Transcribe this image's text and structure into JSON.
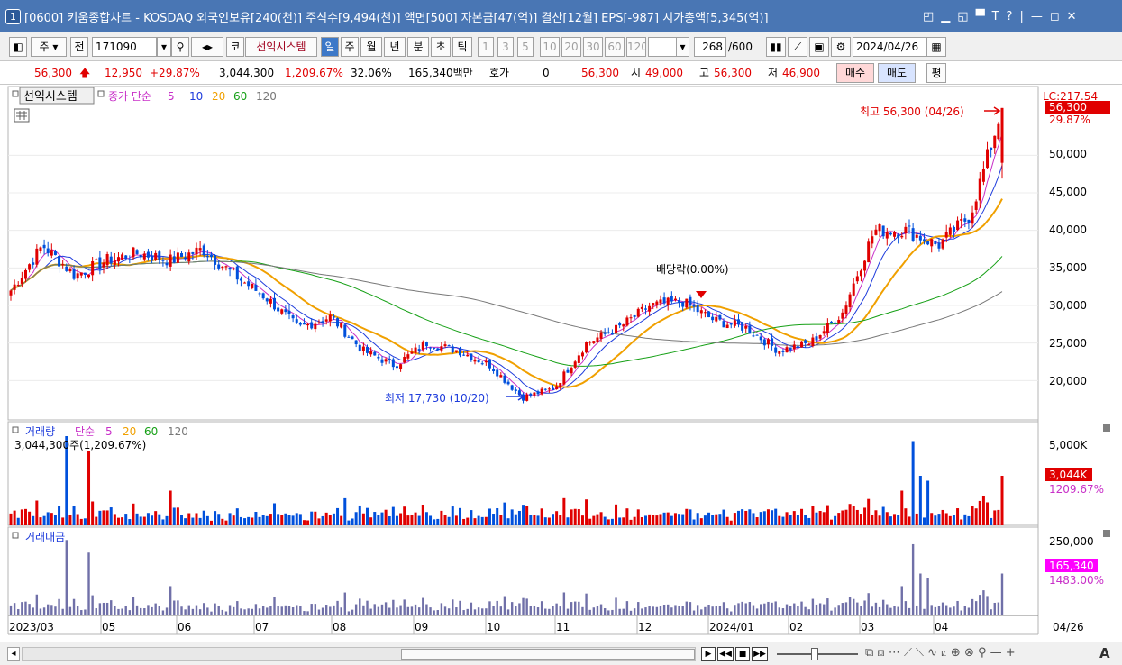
{
  "title": {
    "num": "1",
    "text": "[0600] 키움종합차트 - KOSDAQ 외국인보유[240(천)] 주식수[9,494(천)] 액면[500] 자본금[47(억)] 결산[12월] EPS[-987] 시가총액[5,345(억)]",
    "controls": [
      "◰",
      "▁",
      "◱",
      "▀",
      "T",
      "?",
      "|",
      "—",
      "◻",
      "✕"
    ]
  },
  "toolbar": {
    "period_select": "주",
    "prev_btn": "전",
    "code": "171090",
    "kosdaq_btn": "코",
    "system_name": "선익시스템",
    "periods": [
      "일",
      "주",
      "월",
      "년",
      "분",
      "초",
      "틱"
    ],
    "active_period": "일",
    "intervals": [
      "1",
      "3",
      "5",
      "10",
      "20",
      "30",
      "60",
      "120"
    ],
    "count": "268",
    "count_total": "/600",
    "date": "2024/04/26"
  },
  "quote": {
    "price": "56,300",
    "change": "12,950",
    "change_pct": "+29.87%",
    "volume": "3,044,300",
    "volume_pct": "1,209.67%",
    "turnover": "32.06%",
    "amount": "165,340백만",
    "hoga_label": "호가",
    "hoga_value": "0",
    "hoga_price": "56,300",
    "open_label": "시",
    "open": "49,000",
    "high_label": "고",
    "high": "56,300",
    "low_label": "저",
    "low": "46,900",
    "buy_label": "매수",
    "sell_label": "매도",
    "eval_label": "평"
  },
  "price_panel": {
    "name": "선익시스템",
    "ma_label": "종가 단순",
    "ma_periods": [
      "5",
      "10",
      "20",
      "60",
      "120"
    ],
    "ma_colors": [
      "#c830c8",
      "#1e3cdc",
      "#f0a000",
      "#16a016",
      "#787878"
    ],
    "top_label": "LC:217.54",
    "last_price": "56,300",
    "last_pct": "29.87%",
    "y_ticks": [
      "50,000",
      "45,000",
      "40,000",
      "35,000",
      "30,000",
      "25,000",
      "20,000"
    ],
    "high_annot": "최고 56,300 (04/26)",
    "low_annot": "최저 17,730 (10/20)",
    "dividend_annot": "배당락(0.00%)"
  },
  "volume_panel": {
    "name": "거래량",
    "ma_label": "단순",
    "ma_periods": [
      "5",
      "20",
      "60",
      "120"
    ],
    "value_label": "3,044,300주(1,209.67%)",
    "y_ticks": [
      "5,000K"
    ],
    "last_value": "3,044K",
    "last_pct": "1209.67%"
  },
  "amount_panel": {
    "name": "거래대금",
    "y_ticks": [
      "250,000"
    ],
    "last_value": "165,340",
    "last_pct": "1483.00%"
  },
  "x_axis": {
    "labels": [
      "2023/03",
      "05",
      "06",
      "07",
      "08",
      "09",
      "10",
      "11",
      "12",
      "2024/01",
      "02",
      "03",
      "04"
    ],
    "current": "04/26"
  },
  "chart_data": {
    "type": "candlestick",
    "y_range": [
      15000,
      57000
    ],
    "up_color": "#e00000",
    "down_color": "#0050dc",
    "anchors": [
      [
        "2023/03",
        32000
      ],
      [
        "03",
        38000
      ],
      [
        "03",
        34000
      ],
      [
        "04",
        36000
      ],
      [
        "05",
        37000
      ],
      [
        "05",
        36000
      ],
      [
        "06",
        37500
      ],
      [
        "06",
        34000
      ],
      [
        "06",
        31000
      ],
      [
        "07",
        27000
      ],
      [
        "07",
        28500
      ],
      [
        "08",
        24000
      ],
      [
        "08",
        22000
      ],
      [
        "09",
        25000
      ],
      [
        "09",
        24000
      ],
      [
        "10",
        22000
      ],
      [
        "10",
        17730
      ],
      [
        "11",
        19000
      ],
      [
        "11",
        25000
      ],
      [
        "12",
        27000
      ],
      [
        "12",
        30000
      ],
      [
        "2024/01",
        30500
      ],
      [
        "01",
        28000
      ],
      [
        "02",
        27000
      ],
      [
        "02",
        24000
      ],
      [
        "03",
        25000
      ],
      [
        "03",
        29000
      ],
      [
        "03",
        40000
      ],
      [
        "04",
        40000
      ],
      [
        "04",
        38000
      ],
      [
        "04",
        42000
      ],
      [
        "04/26",
        56300
      ]
    ]
  }
}
